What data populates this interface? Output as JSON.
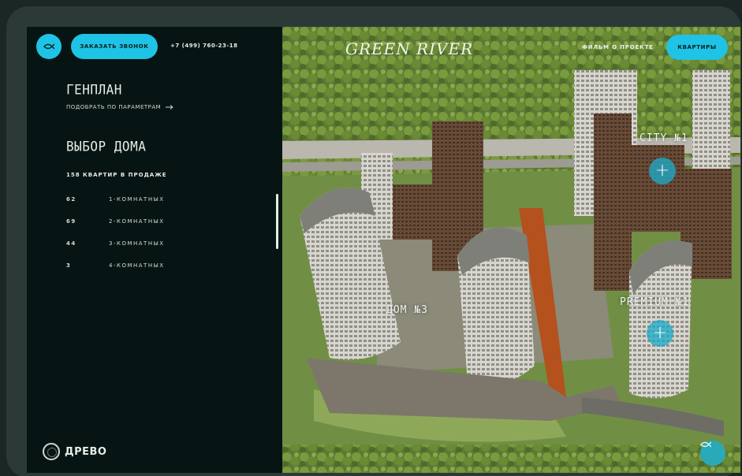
{
  "header": {
    "call_button": "ЗАКАЗАТЬ ЗВОНОК",
    "phone": "+7 (499) 760-23-18",
    "logo": "GREEN RIVER",
    "film_link": "ФИЛЬМ О ПРОЕКТЕ",
    "apartments_button": "КВАРТИРЫ"
  },
  "sidebar": {
    "genplan_title": "ГЕНПЛАН",
    "filter_link": "ПОДОБРАТЬ ПО ПАРАМЕТРАМ",
    "house_title": "ВЫБОР ДОМА",
    "sale_summary": "158 КВАРТИР В ПРОДАЖЕ",
    "apartments": [
      {
        "count": "62",
        "type": "1-КОМНАТНЫХ"
      },
      {
        "count": "69",
        "type": "2-КОМНАТНЫХ"
      },
      {
        "count": "44",
        "type": "3-КОМНАТНЫХ"
      },
      {
        "count": "3",
        "type": "4-КОМНАТНЫХ"
      }
    ],
    "brand": "ДРЕВО"
  },
  "map": {
    "label_city": "СITY №1",
    "label_premium": "PREMIUM №1",
    "label_dom": "ДОМ №3"
  },
  "colors": {
    "accent": "#1ec3e6",
    "panel": "#061513",
    "frame": "#2b3a36"
  }
}
